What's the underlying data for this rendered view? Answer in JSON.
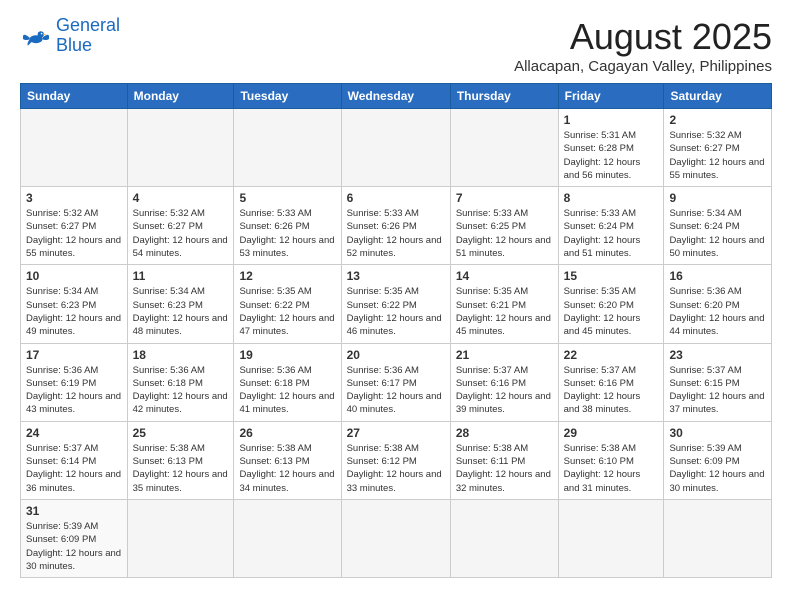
{
  "logo": {
    "line1": "General",
    "line2": "Blue"
  },
  "header": {
    "month": "August 2025",
    "location": "Allacapan, Cagayan Valley, Philippines"
  },
  "weekdays": [
    "Sunday",
    "Monday",
    "Tuesday",
    "Wednesday",
    "Thursday",
    "Friday",
    "Saturday"
  ],
  "weeks": [
    [
      {
        "day": "",
        "info": ""
      },
      {
        "day": "",
        "info": ""
      },
      {
        "day": "",
        "info": ""
      },
      {
        "day": "",
        "info": ""
      },
      {
        "day": "",
        "info": ""
      },
      {
        "day": "1",
        "info": "Sunrise: 5:31 AM\nSunset: 6:28 PM\nDaylight: 12 hours and 56 minutes."
      },
      {
        "day": "2",
        "info": "Sunrise: 5:32 AM\nSunset: 6:27 PM\nDaylight: 12 hours and 55 minutes."
      }
    ],
    [
      {
        "day": "3",
        "info": "Sunrise: 5:32 AM\nSunset: 6:27 PM\nDaylight: 12 hours and 55 minutes."
      },
      {
        "day": "4",
        "info": "Sunrise: 5:32 AM\nSunset: 6:27 PM\nDaylight: 12 hours and 54 minutes."
      },
      {
        "day": "5",
        "info": "Sunrise: 5:33 AM\nSunset: 6:26 PM\nDaylight: 12 hours and 53 minutes."
      },
      {
        "day": "6",
        "info": "Sunrise: 5:33 AM\nSunset: 6:26 PM\nDaylight: 12 hours and 52 minutes."
      },
      {
        "day": "7",
        "info": "Sunrise: 5:33 AM\nSunset: 6:25 PM\nDaylight: 12 hours and 51 minutes."
      },
      {
        "day": "8",
        "info": "Sunrise: 5:33 AM\nSunset: 6:24 PM\nDaylight: 12 hours and 51 minutes."
      },
      {
        "day": "9",
        "info": "Sunrise: 5:34 AM\nSunset: 6:24 PM\nDaylight: 12 hours and 50 minutes."
      }
    ],
    [
      {
        "day": "10",
        "info": "Sunrise: 5:34 AM\nSunset: 6:23 PM\nDaylight: 12 hours and 49 minutes."
      },
      {
        "day": "11",
        "info": "Sunrise: 5:34 AM\nSunset: 6:23 PM\nDaylight: 12 hours and 48 minutes."
      },
      {
        "day": "12",
        "info": "Sunrise: 5:35 AM\nSunset: 6:22 PM\nDaylight: 12 hours and 47 minutes."
      },
      {
        "day": "13",
        "info": "Sunrise: 5:35 AM\nSunset: 6:22 PM\nDaylight: 12 hours and 46 minutes."
      },
      {
        "day": "14",
        "info": "Sunrise: 5:35 AM\nSunset: 6:21 PM\nDaylight: 12 hours and 45 minutes."
      },
      {
        "day": "15",
        "info": "Sunrise: 5:35 AM\nSunset: 6:20 PM\nDaylight: 12 hours and 45 minutes."
      },
      {
        "day": "16",
        "info": "Sunrise: 5:36 AM\nSunset: 6:20 PM\nDaylight: 12 hours and 44 minutes."
      }
    ],
    [
      {
        "day": "17",
        "info": "Sunrise: 5:36 AM\nSunset: 6:19 PM\nDaylight: 12 hours and 43 minutes."
      },
      {
        "day": "18",
        "info": "Sunrise: 5:36 AM\nSunset: 6:18 PM\nDaylight: 12 hours and 42 minutes."
      },
      {
        "day": "19",
        "info": "Sunrise: 5:36 AM\nSunset: 6:18 PM\nDaylight: 12 hours and 41 minutes."
      },
      {
        "day": "20",
        "info": "Sunrise: 5:36 AM\nSunset: 6:17 PM\nDaylight: 12 hours and 40 minutes."
      },
      {
        "day": "21",
        "info": "Sunrise: 5:37 AM\nSunset: 6:16 PM\nDaylight: 12 hours and 39 minutes."
      },
      {
        "day": "22",
        "info": "Sunrise: 5:37 AM\nSunset: 6:16 PM\nDaylight: 12 hours and 38 minutes."
      },
      {
        "day": "23",
        "info": "Sunrise: 5:37 AM\nSunset: 6:15 PM\nDaylight: 12 hours and 37 minutes."
      }
    ],
    [
      {
        "day": "24",
        "info": "Sunrise: 5:37 AM\nSunset: 6:14 PM\nDaylight: 12 hours and 36 minutes."
      },
      {
        "day": "25",
        "info": "Sunrise: 5:38 AM\nSunset: 6:13 PM\nDaylight: 12 hours and 35 minutes."
      },
      {
        "day": "26",
        "info": "Sunrise: 5:38 AM\nSunset: 6:13 PM\nDaylight: 12 hours and 34 minutes."
      },
      {
        "day": "27",
        "info": "Sunrise: 5:38 AM\nSunset: 6:12 PM\nDaylight: 12 hours and 33 minutes."
      },
      {
        "day": "28",
        "info": "Sunrise: 5:38 AM\nSunset: 6:11 PM\nDaylight: 12 hours and 32 minutes."
      },
      {
        "day": "29",
        "info": "Sunrise: 5:38 AM\nSunset: 6:10 PM\nDaylight: 12 hours and 31 minutes."
      },
      {
        "day": "30",
        "info": "Sunrise: 5:39 AM\nSunset: 6:09 PM\nDaylight: 12 hours and 30 minutes."
      }
    ],
    [
      {
        "day": "31",
        "info": "Sunrise: 5:39 AM\nSunset: 6:09 PM\nDaylight: 12 hours and 30 minutes."
      },
      {
        "day": "",
        "info": ""
      },
      {
        "day": "",
        "info": ""
      },
      {
        "day": "",
        "info": ""
      },
      {
        "day": "",
        "info": ""
      },
      {
        "day": "",
        "info": ""
      },
      {
        "day": "",
        "info": ""
      }
    ]
  ]
}
